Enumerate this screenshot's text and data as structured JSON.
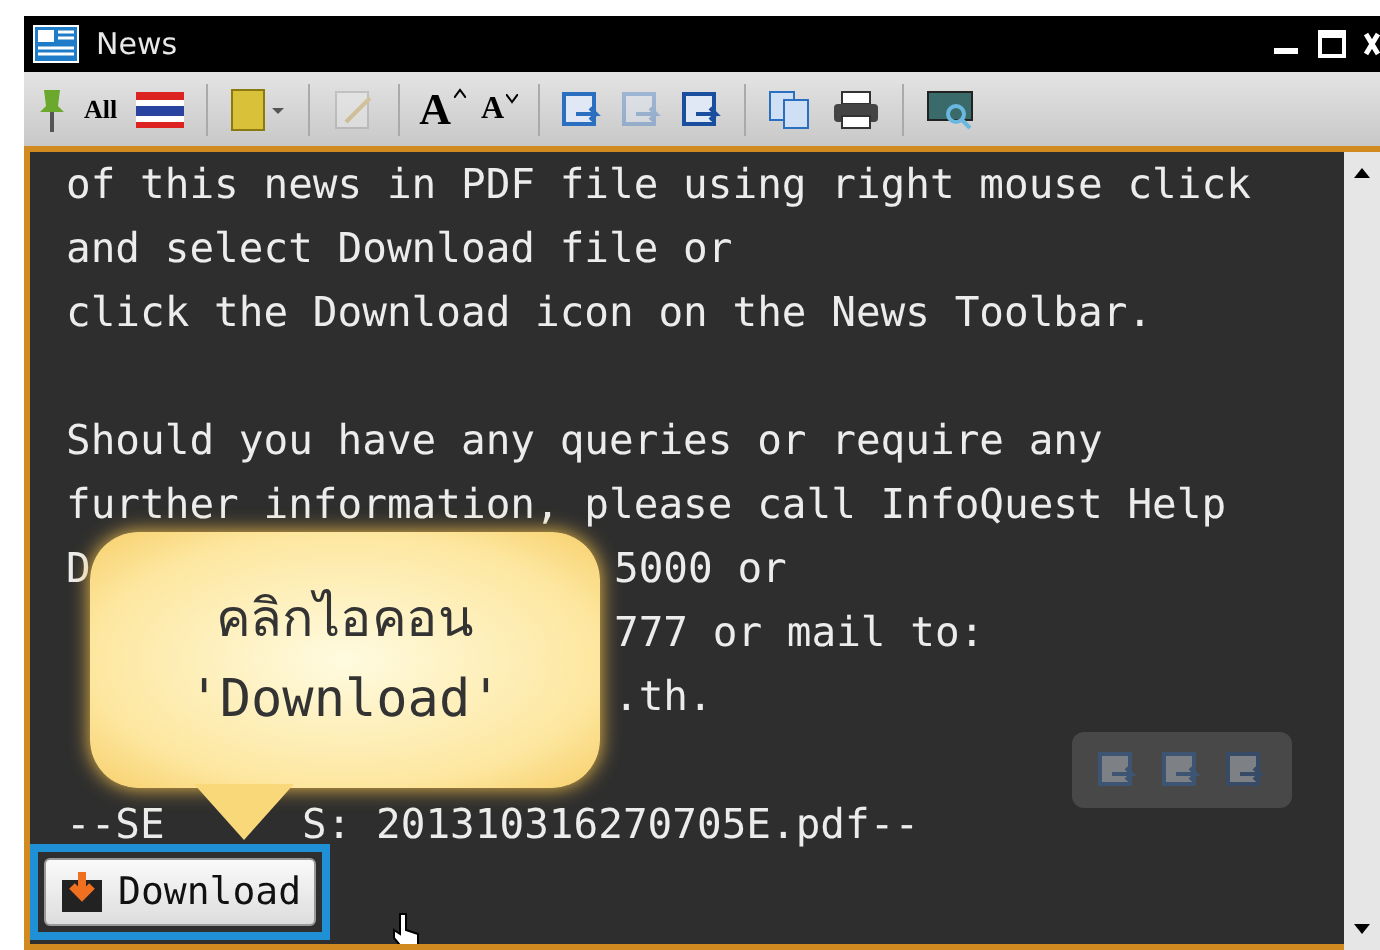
{
  "window": {
    "title": "News"
  },
  "toolbar": {
    "all_label": "All",
    "font_larger_label": "A",
    "font_smaller_label": "A"
  },
  "lines": [
    {
      "kind": "full",
      "text": "of this news in PDF file using right mouse click"
    },
    {
      "kind": "full",
      "text": "and select Download file or"
    },
    {
      "kind": "full",
      "text": "click the Download icon on the News Toolbar."
    },
    {
      "kind": "blank"
    },
    {
      "kind": "full",
      "text": "Should you have any queries or require any"
    },
    {
      "kind": "full",
      "text": "further information, please call InfoQuest Help"
    },
    {
      "kind": "split",
      "left": "D",
      "right": "5000 or"
    },
    {
      "kind": "split",
      "right": "777 or mail to:"
    },
    {
      "kind": "split",
      "right": ".th."
    },
    {
      "kind": "blank"
    },
    {
      "kind": "tail",
      "left": "--SE",
      "right": "S: 201310316270705E.pdf--"
    }
  ],
  "download_button": {
    "label": "Download",
    "selected": true
  },
  "callout": {
    "lines": [
      "คลิกไอคอน",
      "'Download'"
    ]
  }
}
